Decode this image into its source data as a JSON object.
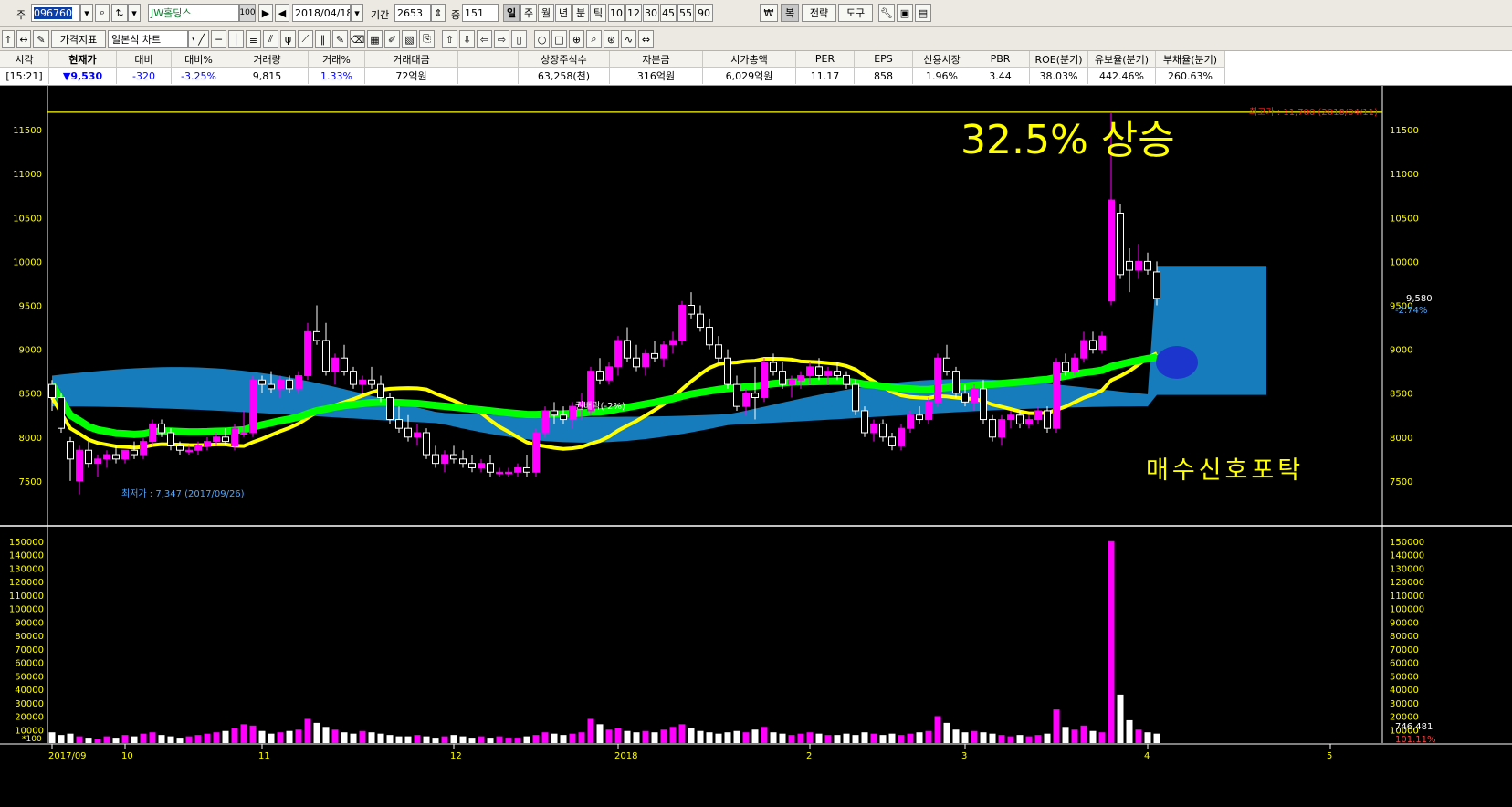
{
  "toolbar": {
    "code_label": "주",
    "stock_code": "096760",
    "stock_name": "JW홀딩스",
    "count_value": "100",
    "date_value": "2018/04/18",
    "period_label": "기간",
    "period_value": "2653",
    "view_label": "중",
    "view_value": "151",
    "periods": [
      "일",
      "주",
      "월",
      "년",
      "분",
      "틱",
      "10",
      "12",
      "30",
      "45",
      "55",
      "90"
    ],
    "won_button": "₩",
    "copy_button": "복",
    "strategy_button": "전략",
    "tools_button": "도구",
    "indicator_button": "가격지표",
    "chart_type": "일본식 차트"
  },
  "info_table": {
    "headers": [
      "시각",
      "현재가",
      "대비",
      "대비%",
      "거래량",
      "거래%",
      "거래대금",
      "",
      "상장주식수",
      "자본금",
      "시가총액",
      "PER",
      "EPS",
      "신용시장",
      "PBR",
      "ROE(분기)",
      "유보율(분기)",
      "부채율(분기)"
    ],
    "values": [
      "[15:21]",
      "▼9,530",
      "-320",
      "-3.25%",
      "9,815",
      "1.33%",
      "72억원",
      "",
      "63,258(천)",
      "316억원",
      "6,029억원",
      "11.17",
      "858",
      "1.96%",
      "3.44",
      "38.03%",
      "442.46%",
      "260.63%"
    ]
  },
  "chart_data": {
    "type": "candlestick",
    "price_axis": {
      "min": 7000,
      "max": 12000,
      "ticks": [
        "11500",
        "11000",
        "10500",
        "10000",
        "9500",
        "9000",
        "8500",
        "8000",
        "7500"
      ]
    },
    "volume_axis": {
      "min": 0,
      "max": 160000,
      "ticks": [
        "150000",
        "140000",
        "130000",
        "120000",
        "110000",
        "100000",
        "90000",
        "80000",
        "70000",
        "60000",
        "50000",
        "40000",
        "30000",
        "20000",
        "10000"
      ],
      "unit": "*100"
    },
    "x_labels": [
      "2017/09",
      "10",
      "11",
      "12",
      "2018",
      "2",
      "3",
      "4",
      "5"
    ],
    "high_annotation": "최고가 : 11,700 (2018/04/11)",
    "low_annotation": "최저가 : 7,347 (2017/09/26)",
    "ex_rights_label": "권배락(-2%)",
    "headline": "32.5% 상승",
    "signal_text": "매수신호포탁",
    "current_price": "9,580",
    "current_change": "-2.74%",
    "current_volume": "746,481",
    "current_volume_pct": "101.11%",
    "high_value": 11700,
    "low_value": 7347,
    "candles": [
      [
        8600,
        8650,
        8300,
        8450
      ],
      [
        8450,
        8500,
        8050,
        8100
      ],
      [
        7950,
        8000,
        7500,
        7750
      ],
      [
        7500,
        7900,
        7347,
        7850
      ],
      [
        7850,
        7950,
        7650,
        7700
      ],
      [
        7700,
        7800,
        7550,
        7750
      ],
      [
        7750,
        7850,
        7650,
        7800
      ],
      [
        7800,
        7900,
        7700,
        7750
      ],
      [
        7750,
        7850,
        7700,
        7850
      ],
      [
        7850,
        7950,
        7750,
        7800
      ],
      [
        7800,
        8000,
        7750,
        7950
      ],
      [
        7950,
        8200,
        7900,
        8150
      ],
      [
        8150,
        8200,
        8000,
        8050
      ],
      [
        8050,
        8100,
        7850,
        7900
      ],
      [
        7900,
        7950,
        7800,
        7850
      ],
      [
        7850,
        7900,
        7800,
        7850
      ],
      [
        7850,
        7950,
        7800,
        7900
      ],
      [
        7900,
        8000,
        7850,
        7950
      ],
      [
        7950,
        8050,
        7900,
        8000
      ],
      [
        8000,
        8100,
        7900,
        7950
      ],
      [
        7900,
        8150,
        7850,
        8100
      ],
      [
        8050,
        8300,
        8000,
        8050
      ],
      [
        8050,
        8700,
        8000,
        8650
      ],
      [
        8650,
        8700,
        8500,
        8600
      ],
      [
        8600,
        8750,
        8500,
        8550
      ],
      [
        8550,
        8700,
        8450,
        8650
      ],
      [
        8650,
        8700,
        8500,
        8550
      ],
      [
        8550,
        8750,
        8500,
        8700
      ],
      [
        8700,
        9300,
        8650,
        9200
      ],
      [
        9200,
        9500,
        9050,
        9100
      ],
      [
        9100,
        9300,
        8700,
        8750
      ],
      [
        8750,
        8950,
        8600,
        8900
      ],
      [
        8900,
        9050,
        8700,
        8750
      ],
      [
        8750,
        8800,
        8550,
        8600
      ],
      [
        8600,
        8700,
        8500,
        8650
      ],
      [
        8650,
        8800,
        8550,
        8600
      ],
      [
        8600,
        8700,
        8400,
        8450
      ],
      [
        8450,
        8500,
        8150,
        8200
      ],
      [
        8200,
        8350,
        8050,
        8100
      ],
      [
        8100,
        8250,
        7950,
        8000
      ],
      [
        8000,
        8150,
        7900,
        8050
      ],
      [
        8050,
        8100,
        7750,
        7800
      ],
      [
        7800,
        7900,
        7650,
        7700
      ],
      [
        7700,
        7850,
        7600,
        7800
      ],
      [
        7800,
        7900,
        7700,
        7750
      ],
      [
        7750,
        7850,
        7650,
        7700
      ],
      [
        7700,
        7800,
        7600,
        7650
      ],
      [
        7650,
        7750,
        7600,
        7700
      ],
      [
        7700,
        7800,
        7550,
        7600
      ],
      [
        7600,
        7650,
        7550,
        7600
      ],
      [
        7600,
        7650,
        7550,
        7600
      ],
      [
        7600,
        7700,
        7550,
        7650
      ],
      [
        7650,
        7800,
        7550,
        7600
      ],
      [
        7600,
        8100,
        7550,
        8050
      ],
      [
        8050,
        8350,
        8000,
        8300
      ],
      [
        8300,
        8400,
        8150,
        8250
      ],
      [
        8250,
        8350,
        8150,
        8200
      ],
      [
        8200,
        8400,
        8100,
        8350
      ],
      [
        8350,
        8500,
        8200,
        8400
      ],
      [
        8300,
        8800,
        8250,
        8750
      ],
      [
        8750,
        8900,
        8600,
        8650
      ],
      [
        8650,
        8850,
        8600,
        8800
      ],
      [
        8800,
        9150,
        8700,
        9100
      ],
      [
        9100,
        9250,
        8850,
        8900
      ],
      [
        8900,
        9050,
        8750,
        8800
      ],
      [
        8800,
        9000,
        8700,
        8950
      ],
      [
        8950,
        9100,
        8850,
        8900
      ],
      [
        8900,
        9100,
        8800,
        9050
      ],
      [
        9050,
        9200,
        8950,
        9100
      ],
      [
        9100,
        9550,
        9050,
        9500
      ],
      [
        9500,
        9650,
        9350,
        9400
      ],
      [
        9400,
        9500,
        9200,
        9250
      ],
      [
        9250,
        9350,
        9000,
        9050
      ],
      [
        9050,
        9150,
        8850,
        8900
      ],
      [
        8900,
        9000,
        8550,
        8600
      ],
      [
        8600,
        8700,
        8300,
        8350
      ],
      [
        8350,
        8550,
        8250,
        8500
      ],
      [
        8500,
        8800,
        8200,
        8450
      ],
      [
        8450,
        8900,
        8400,
        8850
      ],
      [
        8850,
        8950,
        8700,
        8750
      ],
      [
        8750,
        8850,
        8550,
        8600
      ],
      [
        8600,
        8700,
        8450,
        8650
      ],
      [
        8650,
        8750,
        8550,
        8700
      ],
      [
        8700,
        8850,
        8600,
        8800
      ],
      [
        8800,
        8900,
        8650,
        8700
      ],
      [
        8700,
        8800,
        8600,
        8750
      ],
      [
        8750,
        8850,
        8650,
        8700
      ],
      [
        8700,
        8750,
        8550,
        8600
      ],
      [
        8600,
        8650,
        8250,
        8300
      ],
      [
        8300,
        8350,
        8000,
        8050
      ],
      [
        8050,
        8200,
        7950,
        8150
      ],
      [
        8150,
        8200,
        7950,
        8000
      ],
      [
        8000,
        8050,
        7850,
        7900
      ],
      [
        7900,
        8150,
        7850,
        8100
      ],
      [
        8100,
        8300,
        8050,
        8250
      ],
      [
        8250,
        8350,
        8150,
        8200
      ],
      [
        8200,
        8450,
        8150,
        8400
      ],
      [
        8400,
        8950,
        8350,
        8900
      ],
      [
        8900,
        9050,
        8700,
        8750
      ],
      [
        8750,
        8800,
        8450,
        8500
      ],
      [
        8500,
        8600,
        8350,
        8400
      ],
      [
        8400,
        8600,
        8300,
        8550
      ],
      [
        8550,
        8650,
        8150,
        8200
      ],
      [
        8200,
        8250,
        7950,
        8000
      ],
      [
        8000,
        8250,
        7900,
        8200
      ],
      [
        8200,
        8300,
        8100,
        8250
      ],
      [
        8250,
        8300,
        8100,
        8150
      ],
      [
        8150,
        8250,
        8100,
        8200
      ],
      [
        8200,
        8350,
        8150,
        8300
      ],
      [
        8300,
        8350,
        8050,
        8100
      ],
      [
        8100,
        8900,
        8050,
        8850
      ],
      [
        8850,
        8950,
        8700,
        8750
      ],
      [
        8750,
        8950,
        8700,
        8900
      ],
      [
        8900,
        9200,
        8850,
        9100
      ],
      [
        9100,
        9200,
        8950,
        9000
      ],
      [
        9000,
        9200,
        8950,
        9150
      ],
      [
        9550,
        11700,
        9500,
        10700
      ],
      [
        10550,
        10650,
        9800,
        9850
      ],
      [
        10000,
        10150,
        9650,
        9900
      ],
      [
        9900,
        10200,
        9800,
        10000
      ],
      [
        10000,
        10100,
        9850,
        9900
      ],
      [
        9880,
        10000,
        9500,
        9580
      ]
    ],
    "volumes": [
      8000,
      6000,
      7000,
      5000,
      4000,
      3000,
      5000,
      4000,
      6000,
      5000,
      7000,
      8000,
      6000,
      5000,
      4000,
      5000,
      6000,
      7000,
      8000,
      9000,
      11000,
      14000,
      13000,
      9000,
      7000,
      8000,
      9000,
      10000,
      18000,
      15000,
      12000,
      10000,
      8000,
      7000,
      9000,
      8000,
      7000,
      6000,
      5000,
      5000,
      6000,
      5000,
      4000,
      5000,
      6000,
      5000,
      4000,
      5000,
      4000,
      5000,
      4000,
      4000,
      5000,
      6000,
      8000,
      7000,
      6000,
      7000,
      8000,
      18000,
      14000,
      10000,
      11000,
      9000,
      8000,
      9000,
      8000,
      10000,
      12000,
      14000,
      11000,
      9000,
      8000,
      7000,
      8000,
      9000,
      8000,
      10000,
      12000,
      8000,
      7000,
      6000,
      7000,
      8000,
      7000,
      6000,
      6000,
      7000,
      6000,
      8000,
      7000,
      6000,
      7000,
      6000,
      7000,
      8000,
      9000,
      20000,
      15000,
      10000,
      8000,
      9000,
      8000,
      7000,
      6000,
      5000,
      6000,
      5000,
      6000,
      7000,
      25000,
      12000,
      10000,
      13000,
      9000,
      8000,
      150000,
      36000,
      17000,
      10000,
      8000,
      7000
    ]
  },
  "colors": {
    "up": "#ff00ff",
    "down": "#ffffff",
    "cloud": "#1783c5",
    "ma_short": "#ffff00",
    "ma_long": "#00ff00",
    "axis_text": "#ffff00",
    "background": "#000000"
  }
}
